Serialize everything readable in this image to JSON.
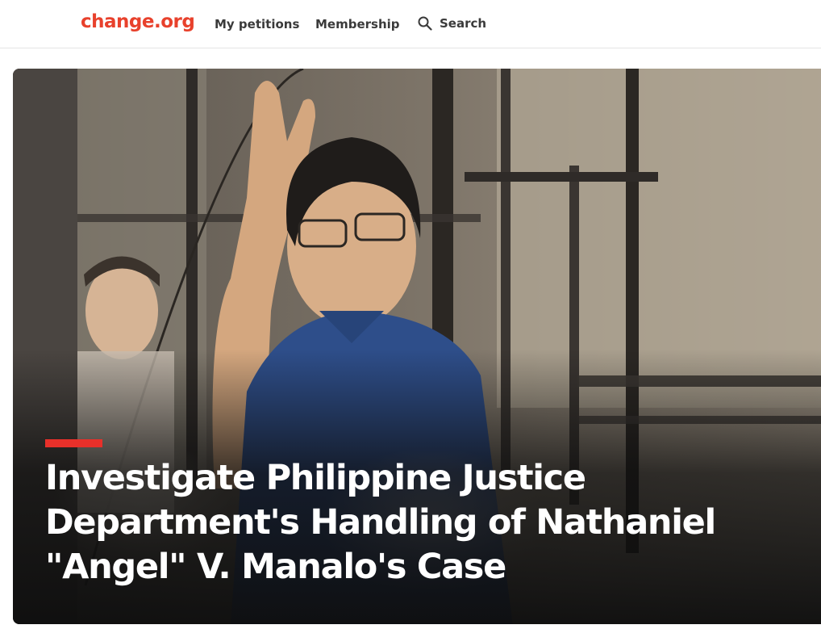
{
  "header": {
    "logo": "change.org",
    "nav": {
      "my_petitions": "My petitions",
      "membership": "Membership",
      "search": "Search"
    },
    "icons": {
      "search": "search-icon"
    }
  },
  "hero": {
    "title": "Investigate Philippine Justice Department's Handling of Nathaniel \"Angel\" V. Manalo's Case",
    "accent_color": "#e8302a"
  },
  "colors": {
    "brand": "#e8412c",
    "nav_text": "#3a3a3a",
    "hero_text": "#ffffff"
  }
}
